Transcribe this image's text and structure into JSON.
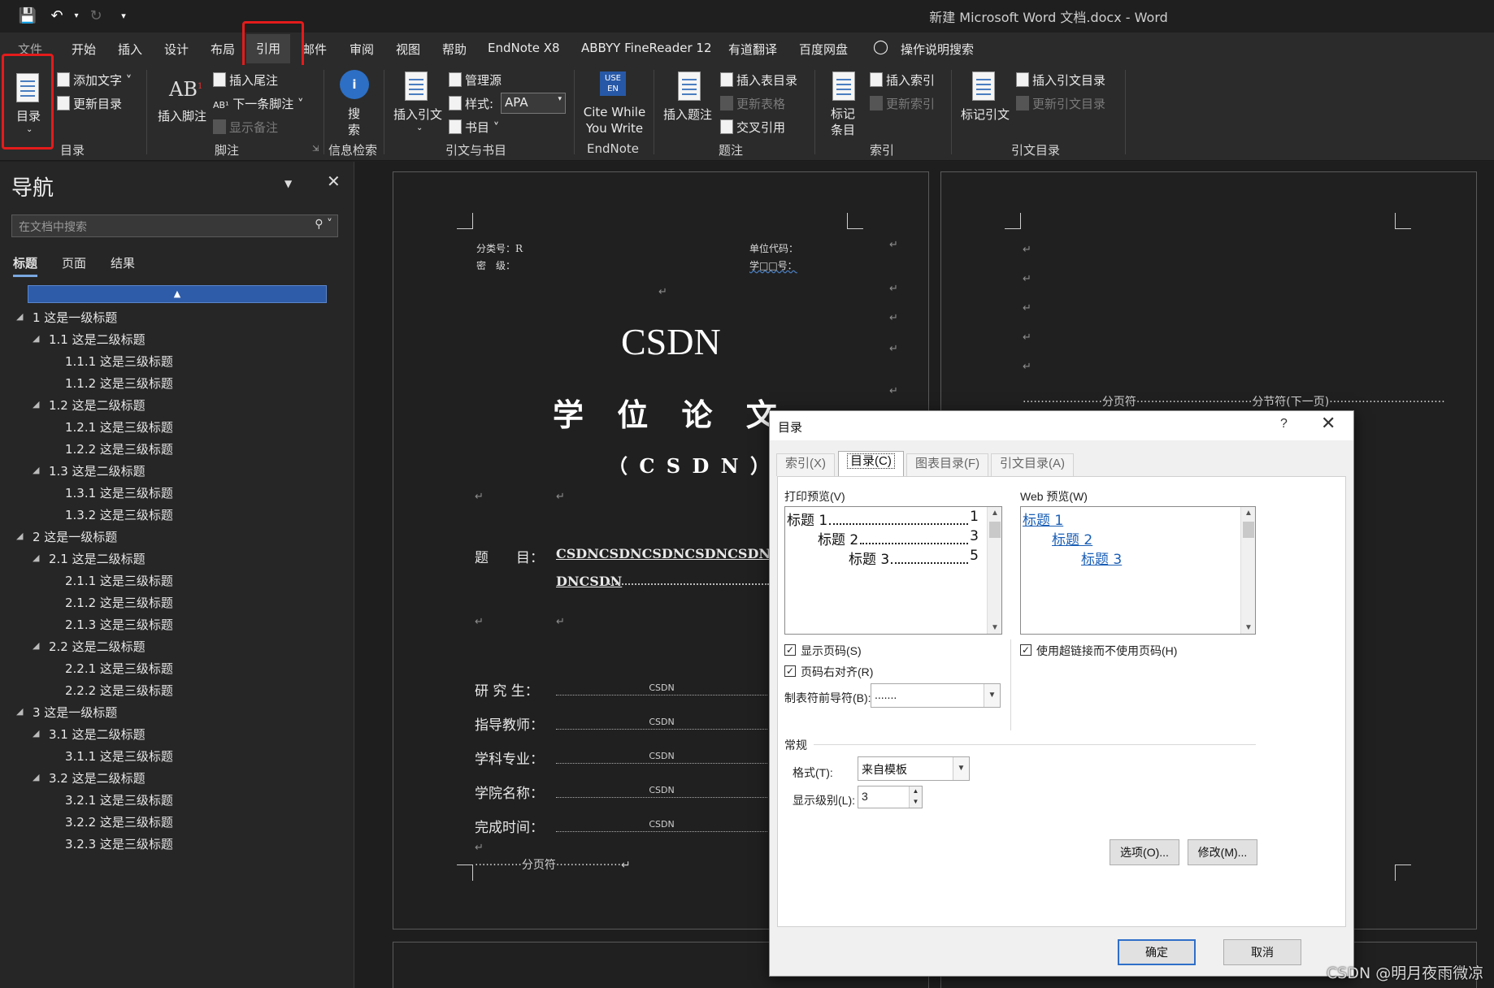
{
  "window": {
    "title": "新建 Microsoft Word 文档.docx  -  Word"
  },
  "menu": {
    "file": "文件",
    "home": "开始",
    "insert": "插入",
    "design": "设计",
    "layout": "布局",
    "references": "引用",
    "mailings": "邮件",
    "review": "审阅",
    "view": "视图",
    "help": "帮助",
    "endnote": "EndNote X8",
    "abbyy": "ABBYY FineReader 12",
    "youdao": "有道翻译",
    "baidu": "百度网盘",
    "tell_me": "操作说明搜索"
  },
  "ribbon": {
    "toc": {
      "button": "目录",
      "add_text": "添加文字",
      "update": "更新目录",
      "group": "目录"
    },
    "footnotes": {
      "insert_footnote": "插入脚注",
      "insert_endnote": "插入尾注",
      "next_footnote": "下一条脚注",
      "show_notes": "显示备注",
      "group": "脚注"
    },
    "research": {
      "search": "搜索",
      "group": "信息检索"
    },
    "citations": {
      "insert_citation": "插入引文",
      "manage_sources": "管理源",
      "style_label": "样式:",
      "style_value": "APA",
      "bibliography": "书目",
      "group": "引文与书目"
    },
    "endnote": {
      "cite_while_you_write": "Cite While You Write",
      "group": "EndNote"
    },
    "captions": {
      "insert_caption": "插入题注",
      "insert_table_of_figures": "插入表目录",
      "update_table": "更新表格",
      "cross_reference": "交叉引用",
      "group": "题注"
    },
    "index": {
      "mark_entry": "标记条目",
      "insert_index": "插入索引",
      "update_index": "更新索引",
      "group": "索引"
    },
    "toa": {
      "mark_citation": "标记引文",
      "insert_toa": "插入引文目录",
      "update_toa": "更新引文目录",
      "group": "引文目录"
    }
  },
  "nav": {
    "title": "导航",
    "search_placeholder": "在文档中搜索",
    "tabs": [
      "标题",
      "页面",
      "结果"
    ],
    "headings": [
      {
        "level": 1,
        "text": "1 这是一级标题"
      },
      {
        "level": 2,
        "text": "1.1 这是二级标题"
      },
      {
        "level": 3,
        "text": "1.1.1 这是三级标题"
      },
      {
        "level": 3,
        "text": "1.1.2 这是三级标题"
      },
      {
        "level": 2,
        "text": "1.2 这是二级标题"
      },
      {
        "level": 3,
        "text": "1.2.1 这是三级标题"
      },
      {
        "level": 3,
        "text": "1.2.2 这是三级标题"
      },
      {
        "level": 2,
        "text": "1.3 这是二级标题"
      },
      {
        "level": 3,
        "text": "1.3.1 这是三级标题"
      },
      {
        "level": 3,
        "text": "1.3.2 这是三级标题"
      },
      {
        "level": 1,
        "text": "2 这是一级标题"
      },
      {
        "level": 2,
        "text": "2.1 这是二级标题"
      },
      {
        "level": 3,
        "text": "2.1.1 这是三级标题"
      },
      {
        "level": 3,
        "text": "2.1.2 这是三级标题"
      },
      {
        "level": 3,
        "text": "2.1.3 这是三级标题"
      },
      {
        "level": 2,
        "text": "2.2 这是二级标题"
      },
      {
        "level": 3,
        "text": "2.2.1 这是三级标题"
      },
      {
        "level": 3,
        "text": "2.2.2 这是三级标题"
      },
      {
        "level": 1,
        "text": "3 这是一级标题"
      },
      {
        "level": 2,
        "text": "3.1 这是二级标题"
      },
      {
        "level": 3,
        "text": "3.1.1 这是三级标题"
      },
      {
        "level": 2,
        "text": "3.2 这是二级标题"
      },
      {
        "level": 3,
        "text": "3.2.1 这是三级标题"
      },
      {
        "level": 3,
        "text": "3.2.2 这是三级标题"
      },
      {
        "level": 3,
        "text": "3.2.3 这是三级标题"
      }
    ]
  },
  "document": {
    "class_no": "分类号：R",
    "secret": "密　级：",
    "unit_code": "单位代码：",
    "student_no": "学□□号：",
    "csdn": "CSDN",
    "thesis": "学 位 论 文",
    "subtitle": "（ C S D N ）",
    "topic_label": "题　　目：",
    "topic_line1": "CSDNCSDNCSDNCSDNCSDNCSDNCS",
    "topic_line2": "DNCSDN",
    "fields": [
      {
        "label": "研 究 生：",
        "value": "CSDN"
      },
      {
        "label": "指导教师：",
        "value": "CSDN"
      },
      {
        "label": "学科专业：",
        "value": "CSDN"
      },
      {
        "label": "学院名称：",
        "value": "CSDN"
      },
      {
        "label": "完成时间：",
        "value": "CSDN"
      }
    ],
    "page_break": "分页符",
    "section_break": "分节符(下一页)"
  },
  "dialog": {
    "title": "目录",
    "help": "?",
    "tabs": [
      "索引(X)",
      "目录(C)",
      "图表目录(F)",
      "引文目录(A)"
    ],
    "print_preview_label": "打印预览(V)",
    "print_preview": [
      {
        "text": "标题 1",
        "page": "1"
      },
      {
        "text": "标题 2",
        "page": "3"
      },
      {
        "text": "标题 3",
        "page": "5"
      }
    ],
    "web_preview_label": "Web 预览(W)",
    "web_preview": [
      "标题 1",
      "标题 2",
      "标题 3"
    ],
    "show_page_numbers": "显示页码(S)",
    "right_align": "页码右对齐(R)",
    "tab_leader_label": "制表符前导符(B):",
    "tab_leader_value": ".......",
    "use_hyperlinks": "使用超链接而不使用页码(H)",
    "general": "常规",
    "formats_label": "格式(T):",
    "formats_value": "来自模板",
    "levels_label": "显示级别(L):",
    "levels_value": "3",
    "options": "选项(O)...",
    "modify": "修改(M)...",
    "ok": "确定",
    "cancel": "取消"
  },
  "watermark": "CSDN @明月夜雨微凉"
}
